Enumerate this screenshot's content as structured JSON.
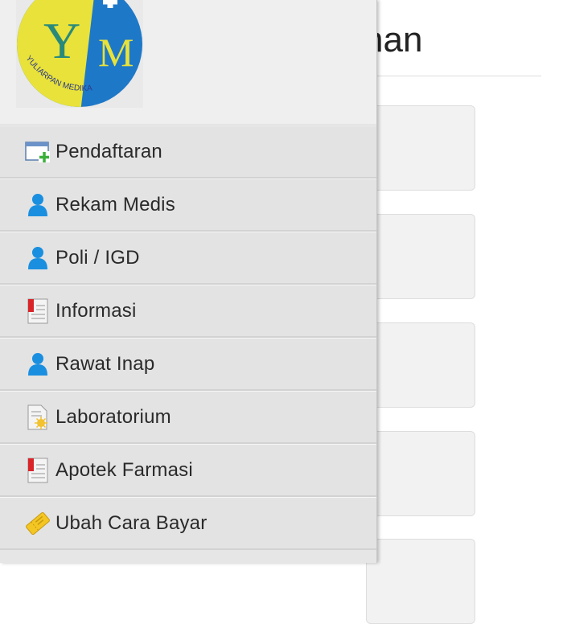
{
  "background": {
    "title_fragment": "han"
  },
  "drawer": {
    "logo": {
      "monogram_left": "Y",
      "monogram_right": "M",
      "brand_text": "YULIARPAN MEDIKA"
    },
    "items": [
      {
        "label": "Pendaftaran",
        "icon": "registration-window-icon"
      },
      {
        "label": "Rekam Medis",
        "icon": "user-icon"
      },
      {
        "label": "Poli / IGD",
        "icon": "user-icon"
      },
      {
        "label": "Informasi",
        "icon": "document-icon"
      },
      {
        "label": "Rawat Inap",
        "icon": "user-icon"
      },
      {
        "label": "Laboratorium",
        "icon": "lab-document-icon"
      },
      {
        "label": "Apotek Farmasi",
        "icon": "document-icon"
      },
      {
        "label": "Ubah Cara Bayar",
        "icon": "ticket-icon"
      }
    ]
  },
  "colors": {
    "logo_yellow": "#e8e23a",
    "logo_blue": "#1e78c8",
    "user_icon_blue": "#1a8fe0"
  }
}
